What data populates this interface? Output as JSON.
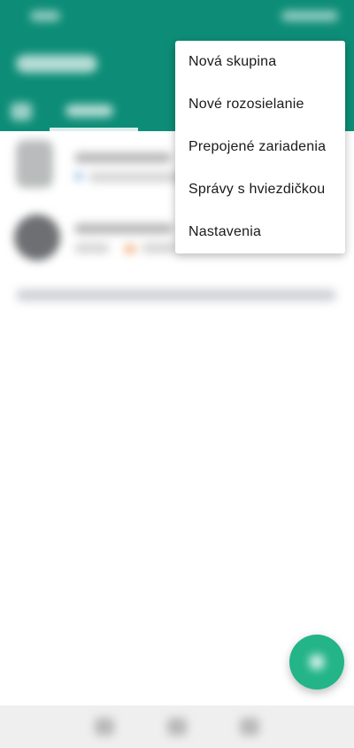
{
  "overflow_menu": {
    "items": [
      {
        "label": "Nová skupina"
      },
      {
        "label": "Nové rozosielanie"
      },
      {
        "label": "Prepojené zariadenia"
      },
      {
        "label": "Správy s hviezdičkou"
      },
      {
        "label": "Nastavenia"
      }
    ]
  },
  "colors": {
    "header": "#0d8d77",
    "fab": "#23b488",
    "menu_background": "#ffffff",
    "menu_text": "#1a1a1a"
  },
  "icons": {
    "fab": "chat-icon",
    "tab_camera": "camera-icon"
  }
}
